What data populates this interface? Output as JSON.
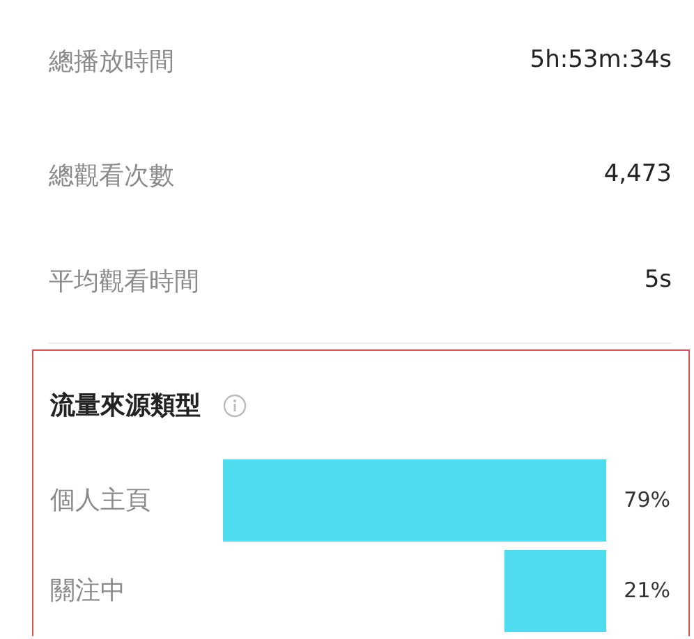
{
  "stats": [
    {
      "label": "總播放時間",
      "value": "5h:53m:34s"
    },
    {
      "label": "總觀看次數",
      "value": "4,473"
    },
    {
      "label": "平均觀看時間",
      "value": "5s"
    }
  ],
  "traffic_sources": {
    "title": "流量來源類型",
    "chart_data": {
      "type": "bar",
      "orientation": "horizontal",
      "categories": [
        "個人主頁",
        "關注中"
      ],
      "values": [
        79,
        21
      ],
      "xlim": [
        79,
        0
      ],
      "data_labels": true,
      "value_labels": [
        "79%",
        "21%"
      ]
    }
  }
}
